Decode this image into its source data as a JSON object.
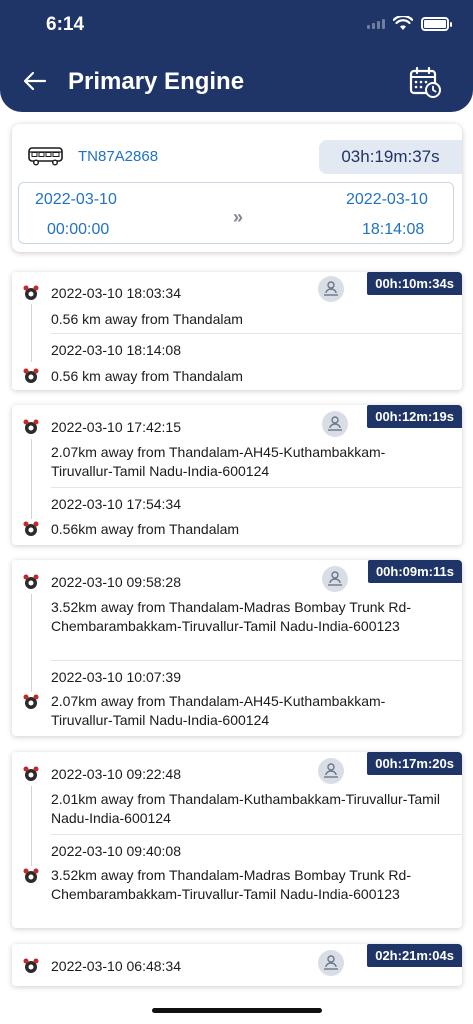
{
  "status_bar": {
    "time": "6:14"
  },
  "header": {
    "title": "Primary Engine"
  },
  "summary": {
    "vehicle_no": "TN87A2868",
    "total_duration": "03h:19m:37s",
    "from_date": "2022-03-10",
    "from_time": "00:00:00",
    "to_date": "2022-03-10",
    "to_time": "18:14:08",
    "arrows": "»"
  },
  "trips": [
    {
      "duration": "00h:10m:34s",
      "start_time": "2022-03-10 18:03:34",
      "start_location": "0.56 km away from Thandalam",
      "end_time": "2022-03-10 18:14:08",
      "end_location": "0.56 km away from Thandalam"
    },
    {
      "duration": "00h:12m:19s",
      "start_time": "2022-03-10 17:42:15",
      "start_location": "2.07km away from Thandalam-AH45-Kuthambakkam-Tiruvallur-Tamil Nadu-India-600124",
      "end_time": "2022-03-10 17:54:34",
      "end_location": "0.56km away from Thandalam"
    },
    {
      "duration": "00h:09m:11s",
      "start_time": "2022-03-10 09:58:28",
      "start_location": "3.52km away from Thandalam-Madras Bombay Trunk Rd-Chembarambakkam-Tiruvallur-Tamil Nadu-India-600123",
      "end_time": "2022-03-10 10:07:39",
      "end_location": "2.07km away from Thandalam-AH45-Kuthambakkam-Tiruvallur-Tamil Nadu-India-600124"
    },
    {
      "duration": "00h:17m:20s",
      "start_time": "2022-03-10 09:22:48",
      "start_location": "2.01km away from Thandalam-Kuthambakkam-Tiruvallur-Tamil Nadu-India-600124",
      "end_time": "2022-03-10 09:40:08",
      "end_location": "3.52km away from Thandalam-Madras Bombay Trunk Rd-Chembarambakkam-Tiruvallur-Tamil Nadu-India-600123"
    },
    {
      "duration": "02h:21m:04s",
      "start_time": "2022-03-10 06:48:34"
    }
  ],
  "icons": {
    "back": "arrow-left-icon",
    "calendar": "calendar-clock-icon",
    "vehicle": "bus-icon",
    "engine": "engine-icon",
    "driver": "person-location-icon"
  },
  "colors": {
    "header": "#1f3467",
    "accent": "#1f73c4",
    "badge": "#1f3467"
  }
}
